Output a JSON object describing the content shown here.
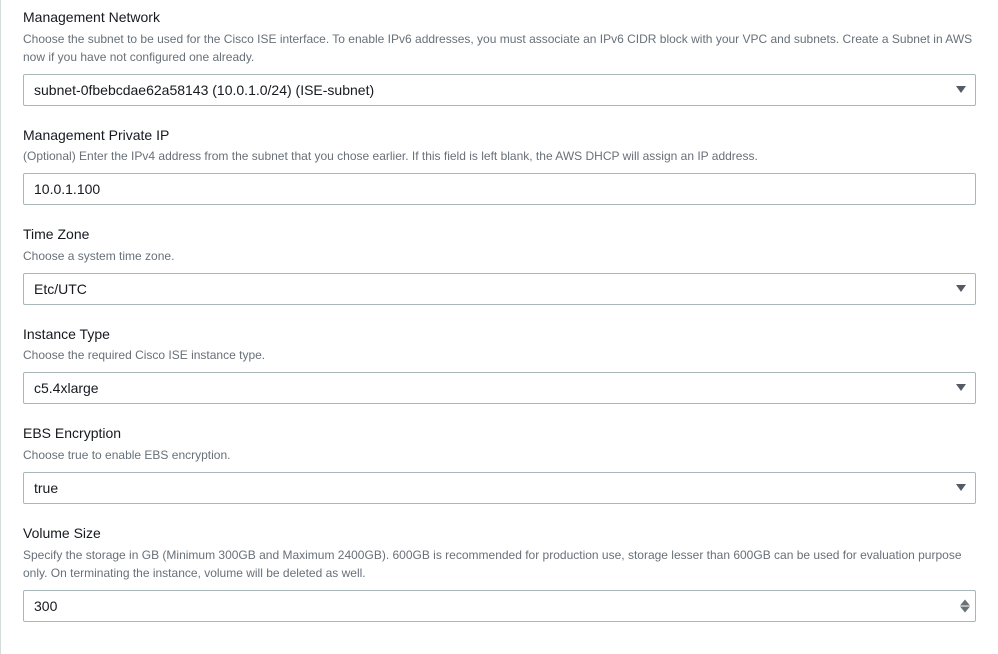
{
  "fields": {
    "mgmt_network": {
      "label": "Management Network",
      "description": "Choose the subnet to be used for the Cisco ISE interface. To enable IPv6 addresses, you must associate an IPv6 CIDR block with your VPC and subnets. Create a Subnet in AWS now if you have not configured one already.",
      "value": "subnet-0fbebcdae62a58143 (10.0.1.0/24) (ISE-subnet)"
    },
    "mgmt_private_ip": {
      "label": "Management Private IP",
      "description": "(Optional) Enter the IPv4 address from the subnet that you chose earlier. If this field is left blank, the AWS DHCP will assign an IP address.",
      "value": "10.0.1.100"
    },
    "time_zone": {
      "label": "Time Zone",
      "description": "Choose a system time zone.",
      "value": "Etc/UTC"
    },
    "instance_type": {
      "label": "Instance Type",
      "description": "Choose the required Cisco ISE instance type.",
      "value": "c5.4xlarge"
    },
    "ebs_encryption": {
      "label": "EBS Encryption",
      "description": "Choose true to enable EBS encryption.",
      "value": "true"
    },
    "volume_size": {
      "label": "Volume Size",
      "description": "Specify the storage in GB (Minimum 300GB and Maximum 2400GB). 600GB is recommended for production use, storage lesser than 600GB can be used for evaluation purpose only. On terminating the instance, volume will be deleted as well.",
      "value": "300"
    }
  }
}
